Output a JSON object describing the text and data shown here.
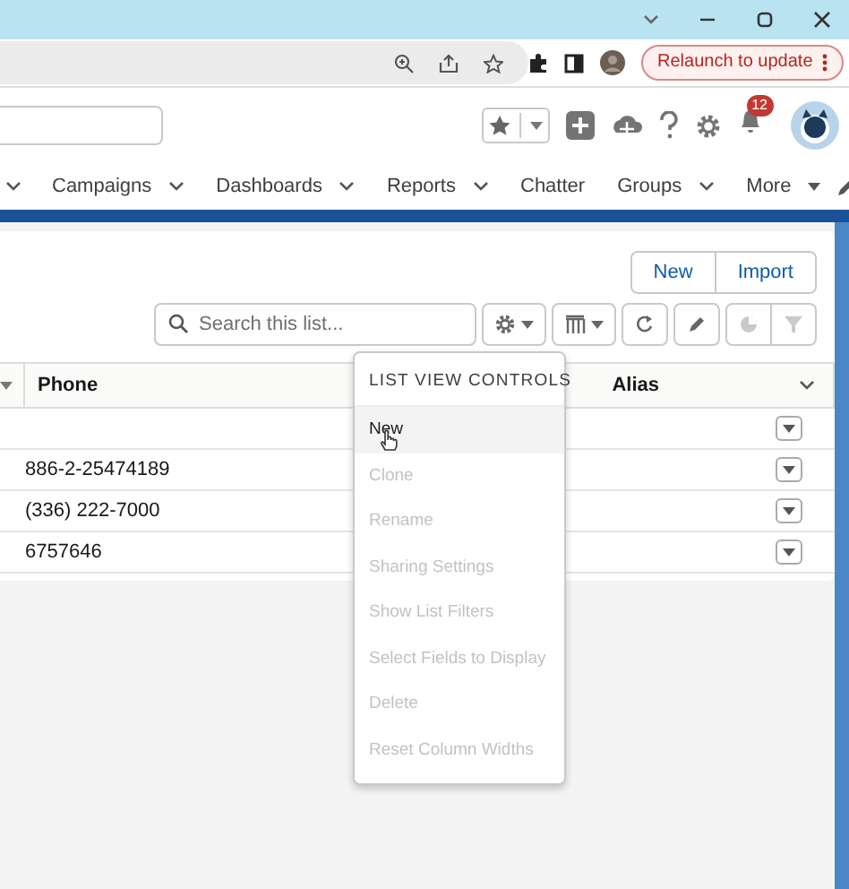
{
  "browser": {
    "relaunch_button": "Relaunch to update"
  },
  "header": {
    "notification_count": "12"
  },
  "nav": {
    "items": [
      {
        "label": "Campaigns",
        "dropdown": true
      },
      {
        "label": "Dashboards",
        "dropdown": true
      },
      {
        "label": "Reports",
        "dropdown": true
      },
      {
        "label": "Chatter",
        "dropdown": false
      },
      {
        "label": "Groups",
        "dropdown": true
      },
      {
        "label": "More",
        "kind": "more"
      }
    ]
  },
  "list": {
    "buttons": [
      "New",
      "Import"
    ],
    "search": {
      "placeholder": "Search this list..."
    },
    "toolbar": [
      {
        "kind": "gear",
        "dropdown": true,
        "disabled": false
      },
      {
        "kind": "table",
        "dropdown": true,
        "disabled": false
      },
      {
        "kind": "refresh",
        "dropdown": false,
        "disabled": false
      },
      {
        "kind": "pencil",
        "dropdown": false,
        "disabled": false
      },
      {
        "kind": "chart",
        "dropdown": false,
        "disabled": true
      },
      {
        "kind": "filter",
        "dropdown": false,
        "disabled": true
      }
    ],
    "columns": [
      "Phone",
      "Alias"
    ],
    "rows": [
      {},
      {
        "phone": "886-2-25474189"
      },
      {
        "phone": "(336) 222-7000"
      },
      {
        "phone": "6757646"
      }
    ]
  },
  "menu": {
    "title": "LIST VIEW CONTROLS",
    "items": [
      {
        "label": "New",
        "disabled": false,
        "highlighted": true
      },
      {
        "label": "Clone",
        "disabled": true,
        "highlighted": false
      },
      {
        "label": "Rename",
        "disabled": true,
        "highlighted": false
      },
      {
        "label": "Sharing Settings",
        "disabled": true,
        "highlighted": false
      },
      {
        "label": "Show List Filters",
        "disabled": true,
        "highlighted": false
      },
      {
        "label": "Select Fields to Display",
        "disabled": true,
        "highlighted": false
      },
      {
        "label": "Delete",
        "disabled": true,
        "highlighted": false
      },
      {
        "label": "Reset Column Widths",
        "disabled": true,
        "highlighted": false
      }
    ]
  }
}
